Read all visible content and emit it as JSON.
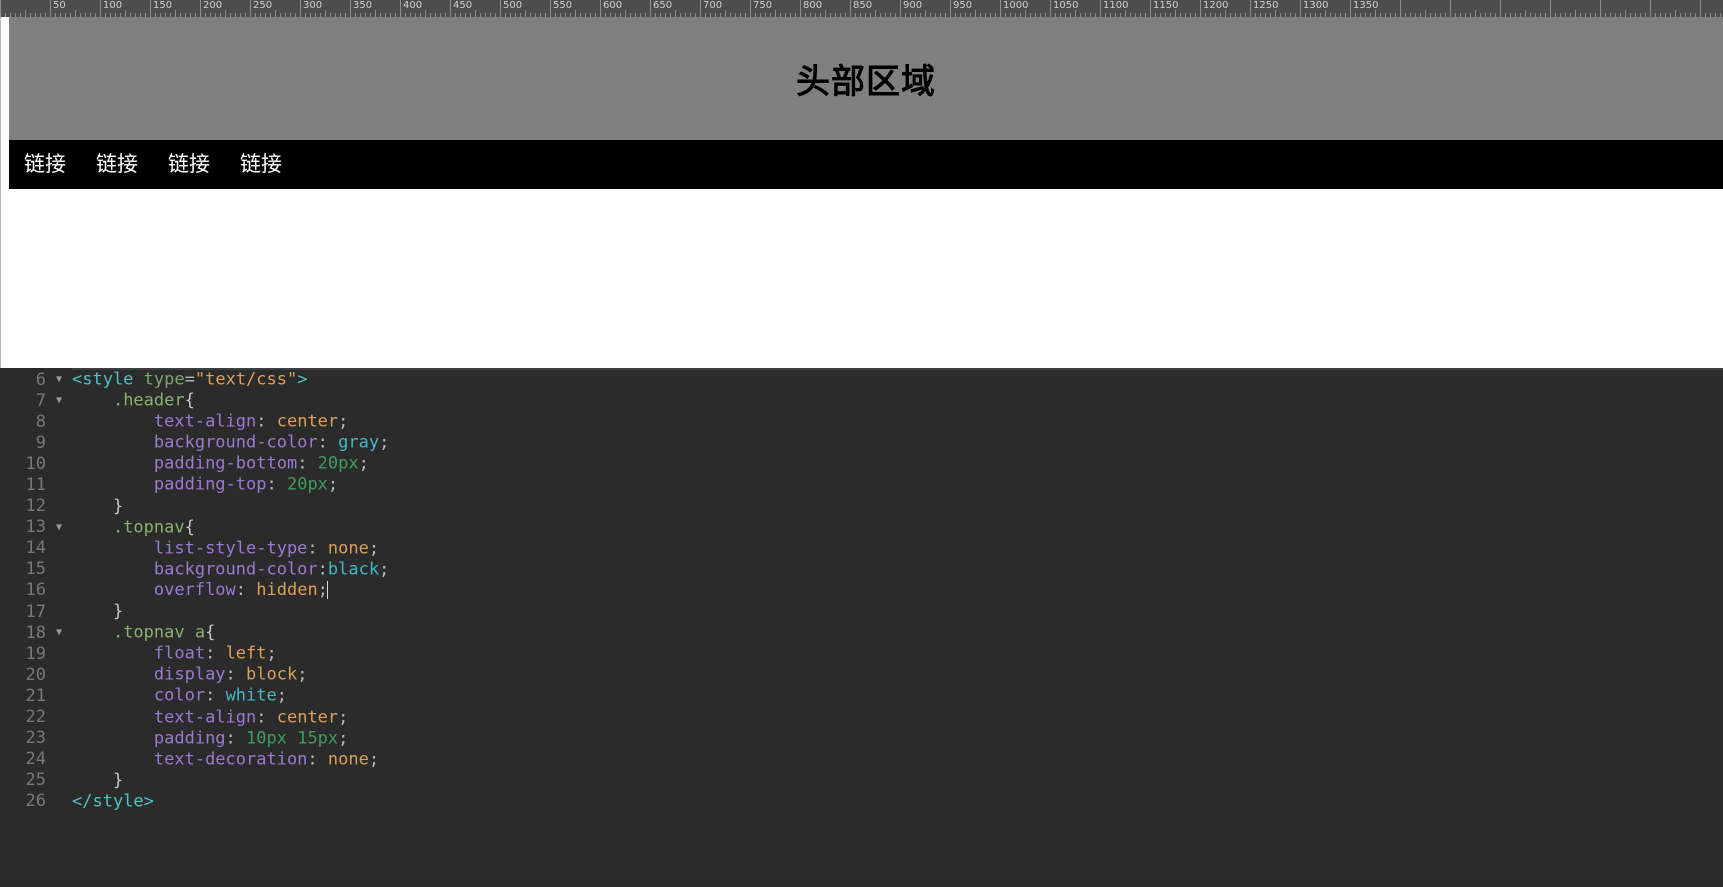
{
  "ruler": {
    "unit": "px",
    "step": 50,
    "labels": [
      50,
      100,
      150,
      200,
      250,
      300,
      350,
      400,
      450,
      500,
      550,
      600,
      650,
      700,
      750,
      800,
      850,
      900,
      950,
      1000,
      1050,
      1100,
      1150,
      1200,
      1250,
      1300,
      1350
    ]
  },
  "preview": {
    "header_title": "头部区域",
    "nav_links": [
      "链接",
      "链接",
      "链接",
      "链接"
    ],
    "header_bg": "#808080",
    "nav_bg": "#000000",
    "nav_link_color": "#ffffff"
  },
  "editor": {
    "background": "#2b2b2b",
    "fold_marker": "▼",
    "lines": [
      {
        "number": "6",
        "fold": true,
        "tokens": [
          {
            "text": "<style",
            "cls": "t-tag"
          },
          {
            "text": " ",
            "cls": "t-plain"
          },
          {
            "text": "type",
            "cls": "t-attr"
          },
          {
            "text": "=",
            "cls": "t-plain"
          },
          {
            "text": "\"text/css\"",
            "cls": "t-string"
          },
          {
            "text": ">",
            "cls": "t-tag"
          }
        ]
      },
      {
        "number": "7",
        "fold": true,
        "tokens": [
          {
            "text": "    ",
            "cls": "t-plain"
          },
          {
            "text": ".header",
            "cls": "t-sel"
          },
          {
            "text": "{",
            "cls": "t-brace"
          }
        ]
      },
      {
        "number": "8",
        "fold": false,
        "tokens": [
          {
            "text": "        ",
            "cls": "t-plain"
          },
          {
            "text": "text-align",
            "cls": "t-prop"
          },
          {
            "text": ": ",
            "cls": "t-plain"
          },
          {
            "text": "center",
            "cls": "t-val"
          },
          {
            "text": ";",
            "cls": "t-plain"
          }
        ]
      },
      {
        "number": "9",
        "fold": false,
        "tokens": [
          {
            "text": "        ",
            "cls": "t-plain"
          },
          {
            "text": "background-color",
            "cls": "t-prop"
          },
          {
            "text": ": ",
            "cls": "t-plain"
          },
          {
            "text": "gray",
            "cls": "t-color"
          },
          {
            "text": ";",
            "cls": "t-plain"
          }
        ]
      },
      {
        "number": "10",
        "fold": false,
        "tokens": [
          {
            "text": "        ",
            "cls": "t-plain"
          },
          {
            "text": "padding-bottom",
            "cls": "t-prop"
          },
          {
            "text": ": ",
            "cls": "t-plain"
          },
          {
            "text": "20px",
            "cls": "t-num"
          },
          {
            "text": ";",
            "cls": "t-plain"
          }
        ]
      },
      {
        "number": "11",
        "fold": false,
        "tokens": [
          {
            "text": "        ",
            "cls": "t-plain"
          },
          {
            "text": "padding-top",
            "cls": "t-prop"
          },
          {
            "text": ": ",
            "cls": "t-plain"
          },
          {
            "text": "20px",
            "cls": "t-num"
          },
          {
            "text": ";",
            "cls": "t-plain"
          }
        ]
      },
      {
        "number": "12",
        "fold": false,
        "tokens": [
          {
            "text": "    ",
            "cls": "t-plain"
          },
          {
            "text": "}",
            "cls": "t-brace"
          }
        ]
      },
      {
        "number": "13",
        "fold": true,
        "tokens": [
          {
            "text": "    ",
            "cls": "t-plain"
          },
          {
            "text": ".topnav",
            "cls": "t-sel"
          },
          {
            "text": "{",
            "cls": "t-brace"
          }
        ]
      },
      {
        "number": "14",
        "fold": false,
        "tokens": [
          {
            "text": "        ",
            "cls": "t-plain"
          },
          {
            "text": "list-style-type",
            "cls": "t-prop"
          },
          {
            "text": ": ",
            "cls": "t-plain"
          },
          {
            "text": "none",
            "cls": "t-val"
          },
          {
            "text": ";",
            "cls": "t-plain"
          }
        ]
      },
      {
        "number": "15",
        "fold": false,
        "tokens": [
          {
            "text": "        ",
            "cls": "t-plain"
          },
          {
            "text": "background-color",
            "cls": "t-prop"
          },
          {
            "text": ":",
            "cls": "t-plain"
          },
          {
            "text": "black",
            "cls": "t-color"
          },
          {
            "text": ";",
            "cls": "t-plain"
          }
        ]
      },
      {
        "number": "16",
        "fold": false,
        "caret": true,
        "tokens": [
          {
            "text": "        ",
            "cls": "t-plain"
          },
          {
            "text": "overflow",
            "cls": "t-prop"
          },
          {
            "text": ": ",
            "cls": "t-plain"
          },
          {
            "text": "hidden",
            "cls": "t-val"
          },
          {
            "text": ";",
            "cls": "t-plain"
          }
        ]
      },
      {
        "number": "17",
        "fold": false,
        "tokens": [
          {
            "text": "    ",
            "cls": "t-plain"
          },
          {
            "text": "}",
            "cls": "t-brace"
          }
        ]
      },
      {
        "number": "18",
        "fold": true,
        "tokens": [
          {
            "text": "    ",
            "cls": "t-plain"
          },
          {
            "text": ".topnav a",
            "cls": "t-sel"
          },
          {
            "text": "{",
            "cls": "t-brace"
          }
        ]
      },
      {
        "number": "19",
        "fold": false,
        "tokens": [
          {
            "text": "        ",
            "cls": "t-plain"
          },
          {
            "text": "float",
            "cls": "t-prop"
          },
          {
            "text": ": ",
            "cls": "t-plain"
          },
          {
            "text": "left",
            "cls": "t-val"
          },
          {
            "text": ";",
            "cls": "t-plain"
          }
        ]
      },
      {
        "number": "20",
        "fold": false,
        "tokens": [
          {
            "text": "        ",
            "cls": "t-plain"
          },
          {
            "text": "display",
            "cls": "t-prop"
          },
          {
            "text": ": ",
            "cls": "t-plain"
          },
          {
            "text": "block",
            "cls": "t-val"
          },
          {
            "text": ";",
            "cls": "t-plain"
          }
        ]
      },
      {
        "number": "21",
        "fold": false,
        "tokens": [
          {
            "text": "        ",
            "cls": "t-plain"
          },
          {
            "text": "color",
            "cls": "t-prop"
          },
          {
            "text": ": ",
            "cls": "t-plain"
          },
          {
            "text": "white",
            "cls": "t-color"
          },
          {
            "text": ";",
            "cls": "t-plain"
          }
        ]
      },
      {
        "number": "22",
        "fold": false,
        "tokens": [
          {
            "text": "        ",
            "cls": "t-plain"
          },
          {
            "text": "text-align",
            "cls": "t-prop"
          },
          {
            "text": ": ",
            "cls": "t-plain"
          },
          {
            "text": "center",
            "cls": "t-val"
          },
          {
            "text": ";",
            "cls": "t-plain"
          }
        ]
      },
      {
        "number": "23",
        "fold": false,
        "tokens": [
          {
            "text": "        ",
            "cls": "t-plain"
          },
          {
            "text": "padding",
            "cls": "t-prop"
          },
          {
            "text": ": ",
            "cls": "t-plain"
          },
          {
            "text": "10px 15px",
            "cls": "t-num"
          },
          {
            "text": ";",
            "cls": "t-plain"
          }
        ]
      },
      {
        "number": "24",
        "fold": false,
        "tokens": [
          {
            "text": "        ",
            "cls": "t-plain"
          },
          {
            "text": "text-decoration",
            "cls": "t-prop"
          },
          {
            "text": ": ",
            "cls": "t-plain"
          },
          {
            "text": "none",
            "cls": "t-val"
          },
          {
            "text": ";",
            "cls": "t-plain"
          }
        ]
      },
      {
        "number": "25",
        "fold": false,
        "tokens": [
          {
            "text": "    ",
            "cls": "t-plain"
          },
          {
            "text": "}",
            "cls": "t-brace"
          }
        ]
      },
      {
        "number": "26",
        "fold": false,
        "tokens": [
          {
            "text": "</style>",
            "cls": "t-tag"
          }
        ]
      }
    ]
  }
}
